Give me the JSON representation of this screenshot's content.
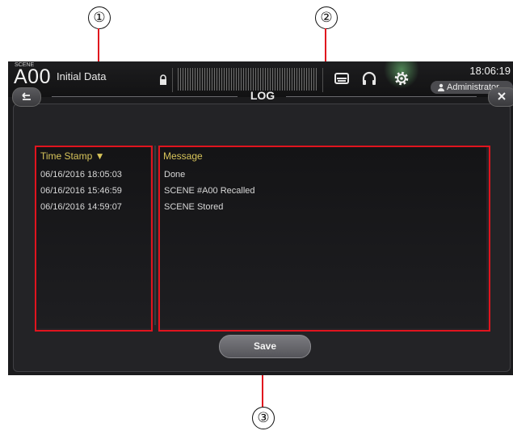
{
  "callouts": [
    "①",
    "②",
    "③"
  ],
  "topbar": {
    "scene_label": "SCENE",
    "scene_number": "A00",
    "scene_title": "Initial Data",
    "time": "18:06:19",
    "user": "Administrator"
  },
  "dialog": {
    "title": "LOG",
    "columns": {
      "timestamp": "Time Stamp ▼",
      "message": "Message"
    },
    "rows": [
      {
        "timestamp": "06/16/2016 18:05:03",
        "message": "Done"
      },
      {
        "timestamp": "06/16/2016 15:46:59",
        "message": "SCENE #A00 Recalled"
      },
      {
        "timestamp": "06/16/2016 14:59:07",
        "message": "SCENE Stored"
      }
    ],
    "save_label": "Save"
  },
  "colors": {
    "highlight": "#e0141e",
    "header_text": "#d7c45a",
    "background": "#1b1b1d"
  },
  "icons": [
    "lock-icon",
    "recorder-icon",
    "headphones-icon",
    "gear-icon",
    "user-icon",
    "back-arrow-icon",
    "close-icon"
  ]
}
